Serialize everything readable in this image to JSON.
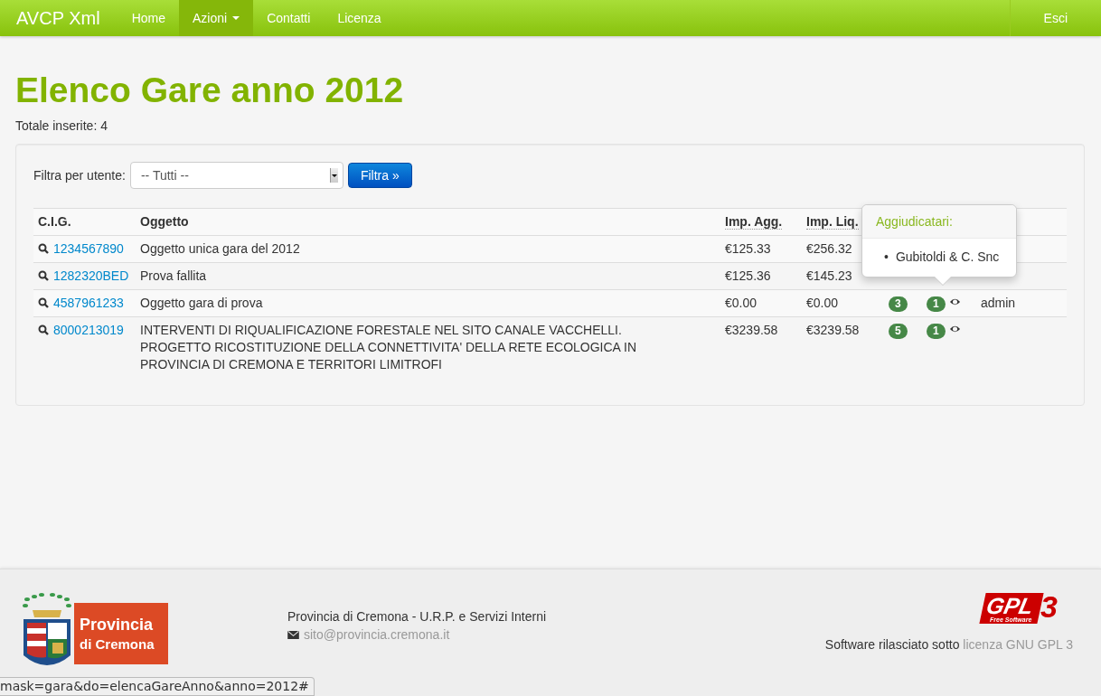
{
  "navbar": {
    "brand": "AVCP Xml",
    "items": [
      {
        "label": "Home",
        "selected": false,
        "dropdown": false
      },
      {
        "label": "Azioni",
        "selected": true,
        "dropdown": true
      },
      {
        "label": "Contatti",
        "selected": false,
        "dropdown": false
      },
      {
        "label": "Licenza",
        "selected": false,
        "dropdown": false
      }
    ],
    "logout": "Esci"
  },
  "page": {
    "title": "Elenco Gare anno 2012",
    "total": "Totale inserite: 4"
  },
  "filter": {
    "label": "Filtra per utente:",
    "value": "-- Tutti --",
    "button": "Filtra »"
  },
  "table": {
    "columns": [
      "C.I.G.",
      "Oggetto",
      "Imp. Agg.",
      "Imp. Liq."
    ],
    "rows": [
      {
        "cig": "1234567890",
        "oggetto": "Oggetto unica gara del 2012",
        "imp_agg": "€125.33",
        "imp_liq": "€256.32"
      },
      {
        "cig": "1282320BED",
        "oggetto": "Prova fallita",
        "imp_agg": "€125.36",
        "imp_liq": "€145.23"
      },
      {
        "cig": "4587961233",
        "oggetto": "Oggetto gara di prova",
        "imp_agg": "€0.00",
        "imp_liq": "€0.00",
        "badges": [
          "3",
          "1"
        ],
        "user": "admin"
      },
      {
        "cig": "8000213019",
        "oggetto": "INTERVENTI DI RIQUALIFICAZIONE FORESTALE NEL SITO CANALE VACCHELLI. PROGETTO RICOSTITUZIONE DELLA CONNETTIVITA' DELLA RETE ECOLOGICA IN PROVINCIA DI CREMONA E TERRITORI LIMITROFI",
        "imp_agg": "€3239.58",
        "imp_liq": "€3239.58",
        "badges": [
          "5",
          "1"
        ]
      }
    ]
  },
  "popover": {
    "title": "Aggiudicatari:",
    "items": [
      {
        "bullet": "•",
        "text": "Gubitoldi & C. Snc"
      }
    ]
  },
  "footer": {
    "logo_lines": [
      "Provincia",
      "di Cremona"
    ],
    "org": "Provincia di Cremona - U.R.P. e Servizi Interni",
    "email": "sito@provincia.cremona.it",
    "gpl_logo": {
      "letters": "GPL",
      "sub": "Free Software",
      "version": "3"
    },
    "license_text": "Software rilasciato sotto",
    "license_link": "licenza GNU GPL 3"
  },
  "status_bar": "mask=gara&do=elencaGareAnno&anno=2012#"
}
